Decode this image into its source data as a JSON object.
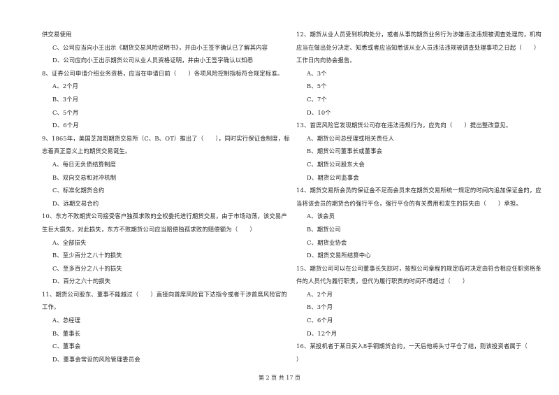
{
  "left_column": [
    {
      "type": "text",
      "text": "供交易使用"
    },
    {
      "type": "option",
      "text": "C、公司应当向小王出示《期货交易风险说明书》，并由小王签字确认已了解其内容"
    },
    {
      "type": "option",
      "text": "D、公司应向小王出示期货公司从业人员资格证明，并由小王签字确认以知悉"
    },
    {
      "type": "question",
      "text": "8、证券公司申请介绍业务资格，应当在申请日前（　　）各项风险控制指标符合规定标准。"
    },
    {
      "type": "option",
      "text": "A、2个月"
    },
    {
      "type": "option",
      "text": "B、3个月"
    },
    {
      "type": "option",
      "text": "C、5个月"
    },
    {
      "type": "option",
      "text": "D、6个月"
    },
    {
      "type": "question",
      "text": "9、1865年，美国芝加哥期货交易所（C、B、OT）推出了（　　），同时实行保证金制度，标"
    },
    {
      "type": "text",
      "text": "志着真正意义上的期货交易诞生。"
    },
    {
      "type": "option",
      "text": "A、每日无负债结算制度"
    },
    {
      "type": "option",
      "text": "B、双向交易和对冲机制"
    },
    {
      "type": "option",
      "text": "C、标准化期货合约"
    },
    {
      "type": "option",
      "text": "D、远期交易合约"
    },
    {
      "type": "question",
      "text": "10、东方不败期货公司接受客户独孤求败的全权委托进行期货交易，由于市场动荡，该交易产"
    },
    {
      "type": "text",
      "text": "生巨大损失，对此损失，东方不败期货公司应当赔偿独孤求败的赔偿额为（　　）"
    },
    {
      "type": "option",
      "text": "A、全部损失"
    },
    {
      "type": "option",
      "text": "B、至少百分之八十的损失"
    },
    {
      "type": "option",
      "text": "C、至多百分之八十的损失"
    },
    {
      "type": "option",
      "text": "D、百分之六十的损失"
    },
    {
      "type": "question",
      "text": "11、期货公司股东、董事不能越过（　　）直接向首席风险官下达指令或者干涉首席风险官的"
    },
    {
      "type": "text",
      "text": "工作。"
    },
    {
      "type": "option",
      "text": "A、总经理"
    },
    {
      "type": "option",
      "text": "B、董事长"
    },
    {
      "type": "option",
      "text": "C、董事会"
    },
    {
      "type": "option",
      "text": "D、董事会常设的风险管理委员会"
    }
  ],
  "right_column": [
    {
      "type": "question",
      "text": "12、期货从业人员受到机构处分，或者从事的期货业务行为涉嫌违法违规被调查处理的，机构"
    },
    {
      "type": "text",
      "text": "应当在做出处分决定、知悉或者应当知悉该从业人员违法违规被调查处理事项之日起（　　）"
    },
    {
      "type": "text",
      "text": "工作日内向协会报告。"
    },
    {
      "type": "option",
      "text": "A、3个"
    },
    {
      "type": "option",
      "text": "B、5个"
    },
    {
      "type": "option",
      "text": "C、7个"
    },
    {
      "type": "option",
      "text": "D、10个"
    },
    {
      "type": "question",
      "text": "13、首席风险官发现期货公司存在违法违规行为，应先向（　　）提出整改意见。"
    },
    {
      "type": "option",
      "text": "A、期货公司总经理或相关责任人"
    },
    {
      "type": "option",
      "text": "B、期货公司董事长或董事会"
    },
    {
      "type": "option",
      "text": "C、期货公司股东大会"
    },
    {
      "type": "option",
      "text": "D、期货公司监事会"
    },
    {
      "type": "question",
      "text": "14、期货交易所会员的保证金不足而会员未在期货交易所统一规定的时间内追加保证金的，应"
    },
    {
      "type": "text",
      "text": "当将该会员的期货合约强行平仓，强行平仓的有关费用和发生的损失由（　　）承担。"
    },
    {
      "type": "option",
      "text": "A、该会员"
    },
    {
      "type": "option",
      "text": "B、期货公司"
    },
    {
      "type": "option",
      "text": "C、期货业协会"
    },
    {
      "type": "option",
      "text": "D、期货交易所结算中心"
    },
    {
      "type": "question",
      "text": "15、期货公司可以在公司董事长失踪时，按照公司章程的规定临时决定由符合相应任职资格条"
    },
    {
      "type": "text",
      "text": "件的人员代为履行职责，但代为履行职责的时间不得超过（　　）"
    },
    {
      "type": "option",
      "text": "A、2个月"
    },
    {
      "type": "option",
      "text": "B、3个月"
    },
    {
      "type": "option",
      "text": "C、6个月"
    },
    {
      "type": "option",
      "text": "D、12个月"
    },
    {
      "type": "question",
      "text": "16、某投机者于某日买入8手铜期货合约，一天后他将头寸平仓了结，则该投资者属于（"
    },
    {
      "type": "text",
      "text": "）"
    }
  ],
  "footer": {
    "page_label": "第 2 页 共 17 页"
  }
}
